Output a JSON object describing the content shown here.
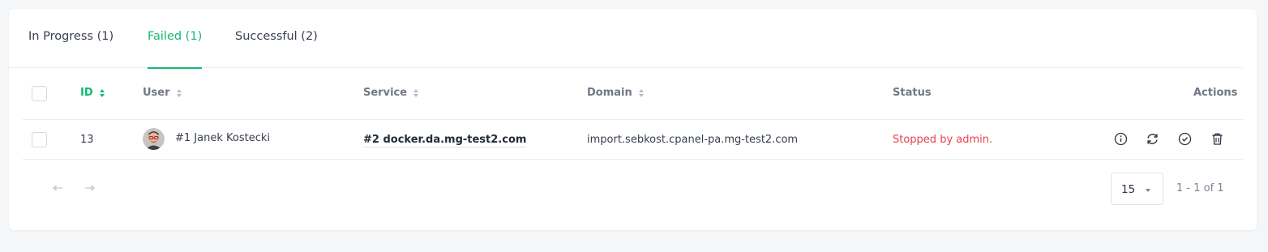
{
  "tabs": [
    {
      "label": "In Progress (1)",
      "active": false
    },
    {
      "label": "Failed (1)",
      "active": true
    },
    {
      "label": "Successful (2)",
      "active": false
    }
  ],
  "table": {
    "columns": {
      "id": "ID",
      "user": "User",
      "service": "Service",
      "domain": "Domain",
      "status": "Status",
      "actions": "Actions"
    },
    "sorted_column": "id",
    "rows": [
      {
        "id": "13",
        "user": "#1 Janek Kostecki",
        "service": "#2 docker.da.mg-test2.com",
        "domain": "import.sebkost.cpanel-pa.mg-test2.com",
        "status": "Stopped by admin."
      }
    ],
    "row_actions": [
      "info-icon",
      "refresh-icon",
      "check-circle-icon",
      "trash-icon"
    ]
  },
  "pagination": {
    "per_page": "15",
    "range_text": "1 - 1 of 1"
  },
  "colors": {
    "accent": "#14b873",
    "error": "#e8414a"
  }
}
